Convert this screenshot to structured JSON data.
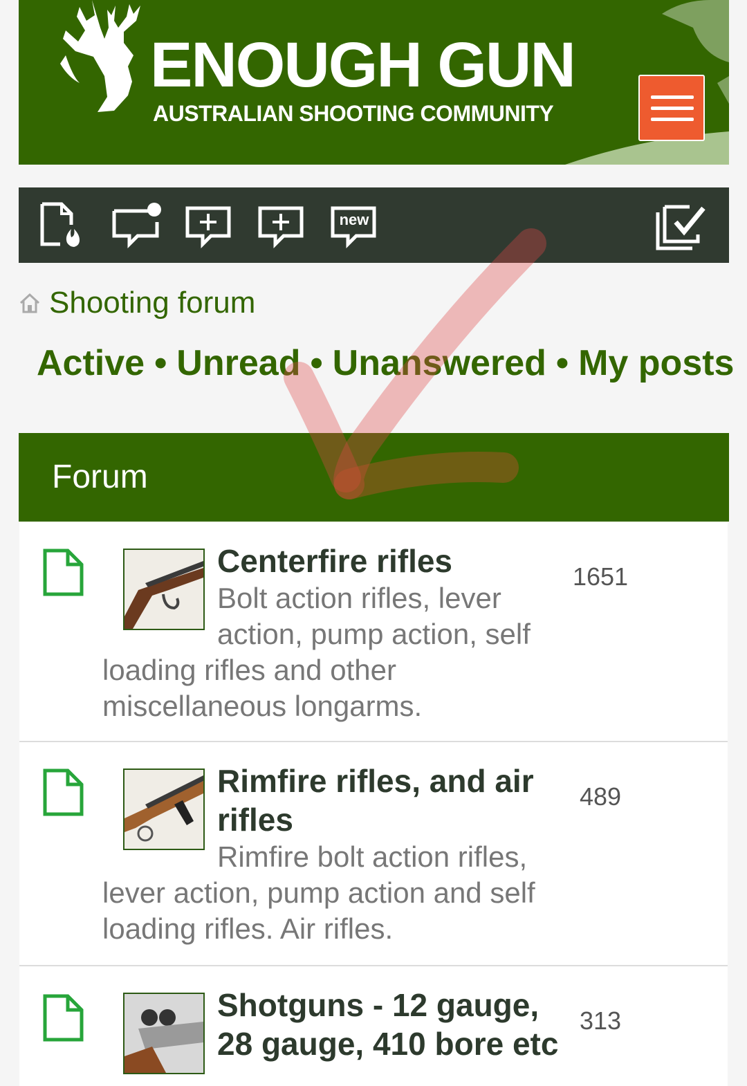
{
  "site": {
    "name": "ENOUGH GUN",
    "tagline": "AUSTRALIAN SHOOTING COMMUNITY"
  },
  "toolbar": {
    "icons": [
      "new-posts-fire-icon",
      "new-message-icon",
      "new-topic-icon",
      "new-reply-icon",
      "new-badge-icon",
      "mark-read-icon"
    ],
    "new_badge_text": "new"
  },
  "breadcrumb": {
    "label": "Shooting forum"
  },
  "quicklinks": {
    "active": "Active",
    "unread": "Unread",
    "unanswered": "Unanswered",
    "my_posts": "My posts",
    "separator": "•"
  },
  "forum": {
    "header": "Forum",
    "rows": [
      {
        "title": "Centerfire rifles",
        "description": "Bolt action rifles, lever action, pump action, self loading rifles and other miscellaneous longarms.",
        "count": "1651"
      },
      {
        "title": "Rimfire rifles, and air rifles",
        "description": "Rimfire bolt action rifles, lever action, pump action and self loading rifles. Air rifles.",
        "count": "489"
      },
      {
        "title": "Shotguns - 12 gauge, 28 gauge, 410 bore etc",
        "description": "",
        "count": "313"
      }
    ]
  },
  "colors": {
    "brand_green": "#336600",
    "toolbar_dark": "#303a30",
    "menu_orange": "#ee5b2f",
    "annotation_red": "#e04848"
  }
}
